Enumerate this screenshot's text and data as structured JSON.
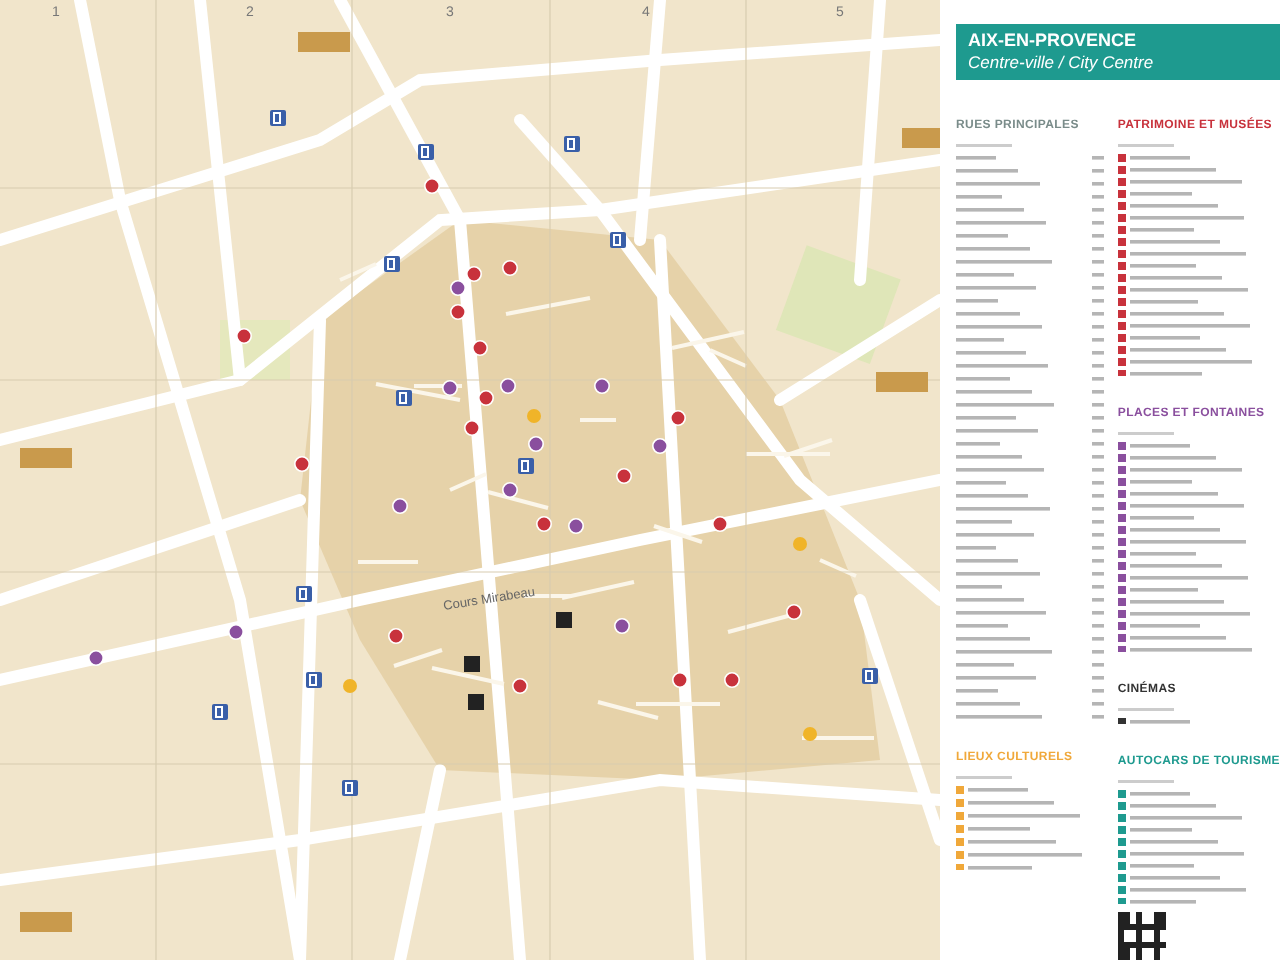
{
  "map": {
    "grid_labels": [
      "1",
      "2",
      "3",
      "4",
      "5"
    ],
    "street_label": "Cours Mirabeau"
  },
  "legend": {
    "title": "AIX-EN-PROVENCE",
    "subtitle": "Centre-ville / City Centre",
    "left_column": [
      {
        "title": "RUES PRINCIPALES",
        "color": "#7a8c8a"
      },
      {
        "title": "LIEUX CULTURELS",
        "color": "#f0a83a"
      }
    ],
    "right_column": [
      {
        "title": "PATRIMOINE ET MUSÉES",
        "color": "#c8323c"
      },
      {
        "title": "PLACES ET FONTAINES",
        "color": "#8a4f9e"
      },
      {
        "title": "CINÉMAS",
        "color": "#333333"
      },
      {
        "title": "AUTOCARS DE TOURISME",
        "color": "#1e9a8f"
      }
    ]
  }
}
